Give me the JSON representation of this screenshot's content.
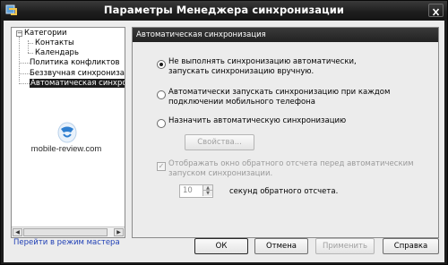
{
  "window": {
    "title": "Параметры Менеджера синхронизации"
  },
  "tree": {
    "items": [
      {
        "label": "Категории",
        "expander": "−"
      },
      {
        "label": "Контакты"
      },
      {
        "label": "Календарь"
      },
      {
        "label": "Политика конфликтов"
      },
      {
        "label": "Беззвучная синхронизац"
      },
      {
        "label": "Автоматическая синхро"
      }
    ]
  },
  "logo": {
    "text": "mobile-review.com"
  },
  "panel": {
    "header": "Автоматическая синхронизация",
    "option1": {
      "line1": "Не выполнять синхронизацию автоматически,",
      "line2": "запускать синхронизацию вручную."
    },
    "option2": {
      "line1": "Автоматически запускать синхронизацию при каждом",
      "line2": "подключении мобильного телефона"
    },
    "option3": {
      "line1": "Назначить автоматическую синхронизацию"
    },
    "properties_button": "Свойства...",
    "countdown_check": {
      "line1": "Отображать окно обратного отсчета перед автоматическим",
      "line2": "запуском синхронизации."
    },
    "countdown": {
      "value": "10",
      "suffix": "секунд обратного отсчета."
    }
  },
  "footer": {
    "wizard_link": "Перейти в режим мастера",
    "ok": "ОК",
    "cancel": "Отмена",
    "apply": "Применить",
    "help": "Справка"
  }
}
